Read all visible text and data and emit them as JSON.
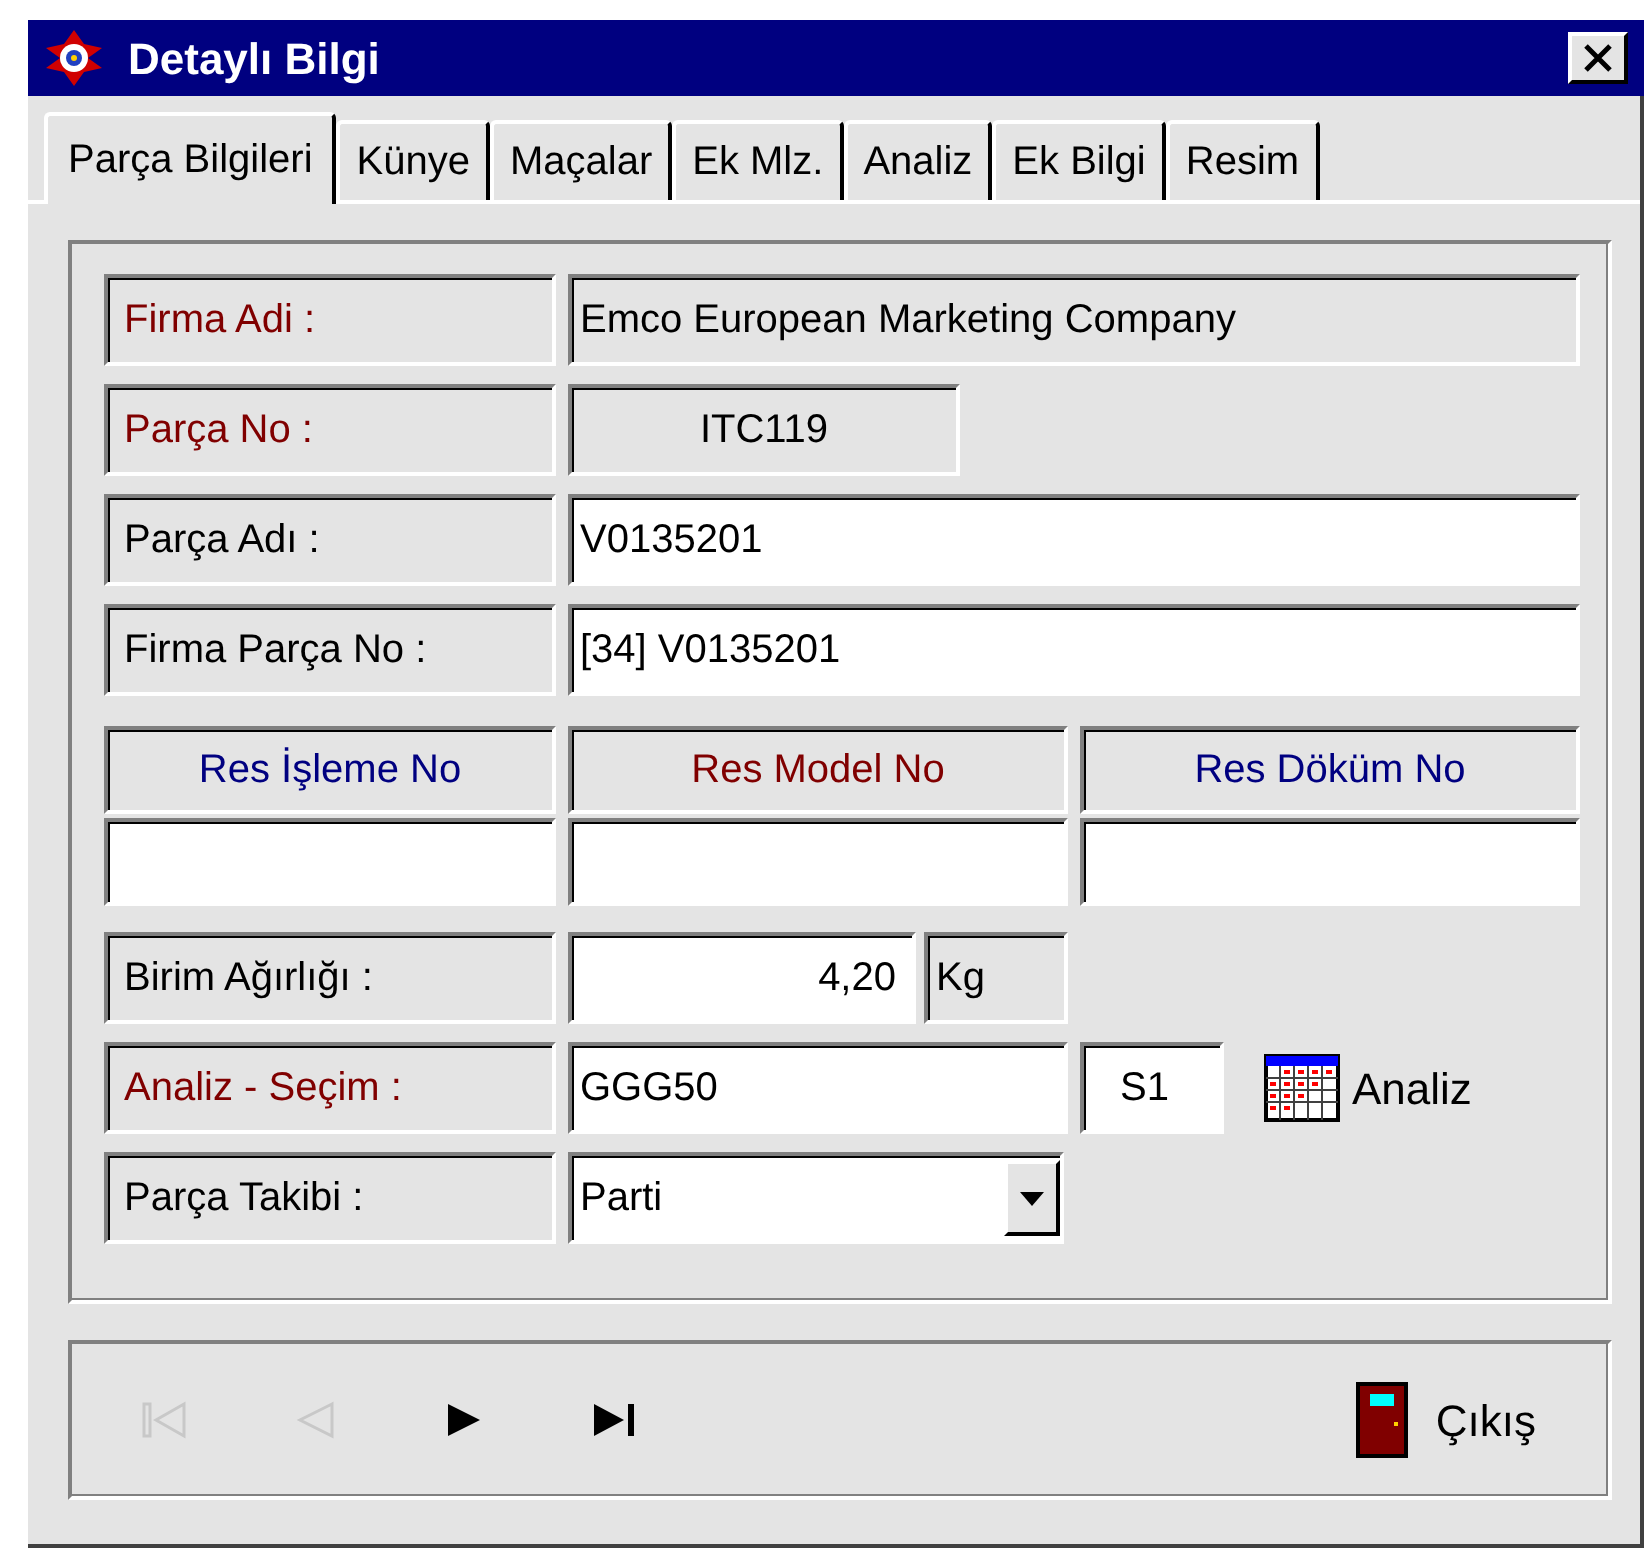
{
  "window": {
    "title": "Detaylı Bilgi"
  },
  "tabs": [
    {
      "label": "Parça Bilgileri",
      "selected": true
    },
    {
      "label": "Künye",
      "selected": false
    },
    {
      "label": "Maçalar",
      "selected": false
    },
    {
      "label": "Ek Mlz.",
      "selected": false
    },
    {
      "label": "Analiz",
      "selected": false
    },
    {
      "label": "Ek Bilgi",
      "selected": false
    },
    {
      "label": "Resim",
      "selected": false
    }
  ],
  "fields": [
    {
      "label": "Firma Adi :",
      "color": "#800000",
      "value": "Emco European Marketing Company",
      "kind": "readonly"
    },
    {
      "label": "Parça No :",
      "color": "#800000",
      "value": "ITC119",
      "kind": "readonly-short"
    },
    {
      "label": "Parça Adı :",
      "color": "#000000",
      "value": "V0135201",
      "kind": "input"
    },
    {
      "label": "Firma Parça No :",
      "color": "#000000",
      "value": "[34] V0135201",
      "kind": "input"
    }
  ],
  "drawing_numbers": [
    {
      "label": "Res İşleme No",
      "color": "#000080"
    },
    {
      "label": "Res Model No",
      "color": "#800000"
    },
    {
      "label": "Res Döküm No",
      "color": "#000080"
    }
  ],
  "weight": {
    "label": "Birim Ağırlığı :",
    "color": "#000000",
    "value": "4,20",
    "unit": "Kg"
  },
  "analysis": {
    "label": "Analiz - Seçim :",
    "color": "#800000",
    "value": "GGG50",
    "code": "S1",
    "button": "Analiz"
  },
  "tracking": {
    "label": "Parça Takibi :",
    "color": "#000000",
    "value": "Parti"
  },
  "navigation": [
    {
      "kind": "first",
      "disabled": true
    },
    {
      "kind": "prev",
      "disabled": true
    },
    {
      "kind": "next",
      "disabled": false
    },
    {
      "kind": "last",
      "disabled": false
    }
  ],
  "exit_button": "Çıkış"
}
